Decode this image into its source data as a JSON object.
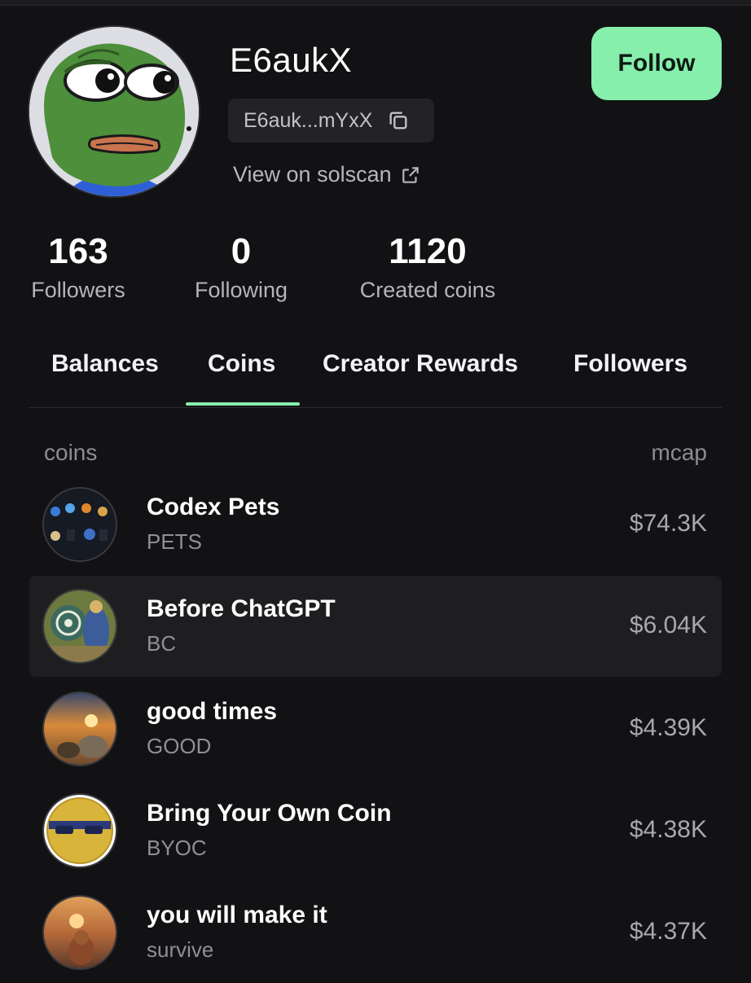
{
  "profile": {
    "username": "E6aukX",
    "address_short": "E6auk...mYxX",
    "solscan_label": "View on solscan",
    "follow_label": "Follow"
  },
  "stats": [
    {
      "value": "163",
      "label": "Followers"
    },
    {
      "value": "0",
      "label": "Following"
    },
    {
      "value": "1120",
      "label": "Created coins"
    }
  ],
  "tabs": [
    {
      "label": "Balances",
      "active": false
    },
    {
      "label": "Coins",
      "active": true
    },
    {
      "label": "Creator Rewards",
      "active": false
    },
    {
      "label": "Followers",
      "active": false
    }
  ],
  "coins_table": {
    "col_coins": "coins",
    "col_mcap": "mcap",
    "rows": [
      {
        "name": "Codex Pets",
        "symbol": "PETS",
        "mcap": "$74.3K",
        "highlighted": false
      },
      {
        "name": "Before ChatGPT",
        "symbol": "BC",
        "mcap": "$6.04K",
        "highlighted": true
      },
      {
        "name": "good times",
        "symbol": "GOOD",
        "mcap": "$4.39K",
        "highlighted": false
      },
      {
        "name": "Bring Your Own Coin",
        "symbol": "BYOC",
        "mcap": "$4.38K",
        "highlighted": false
      },
      {
        "name": "you will make it",
        "symbol": "survive",
        "mcap": "$4.37K",
        "highlighted": false
      }
    ]
  },
  "colors": {
    "accent": "#86efac",
    "background": "#121214",
    "row_highlight": "#1e1e21"
  }
}
